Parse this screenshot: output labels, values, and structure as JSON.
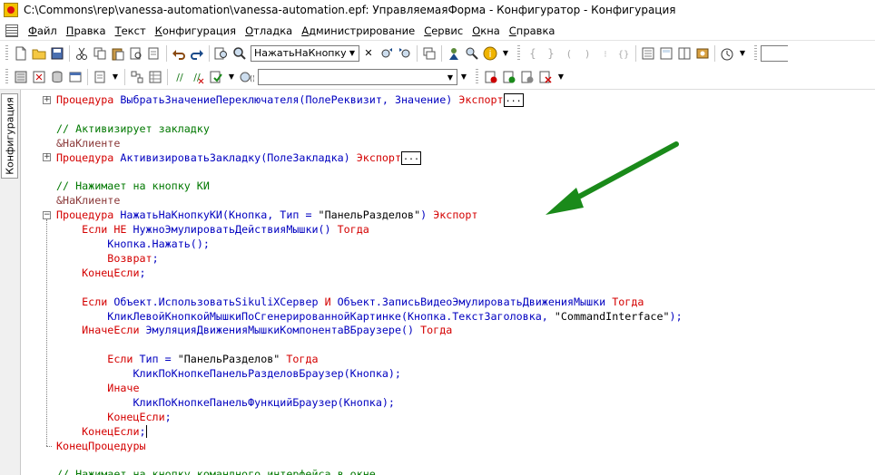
{
  "window": {
    "title": "C:\\Commons\\rep\\vanessa-automation\\vanessa-automation.epf: УправляемаяФорма - Конфигуратор - Конфигурация"
  },
  "menu": [
    {
      "u": "Ф",
      "rest": "айл"
    },
    {
      "u": "П",
      "rest": "равка"
    },
    {
      "u": "Т",
      "rest": "екст"
    },
    {
      "u": "К",
      "rest": "онфигурация"
    },
    {
      "u": "О",
      "rest": "тладка"
    },
    {
      "u": "А",
      "rest": "дминистрирование"
    },
    {
      "u": "С",
      "rest": "ервис"
    },
    {
      "u": "О",
      "rest": "кна"
    },
    {
      "u": "С",
      "rest": "правка"
    }
  ],
  "toolbar": {
    "search_value": "НажатьНаКнопкуКИ",
    "second_combo_value": ""
  },
  "side_panel": {
    "tab_label": "Конфигурация"
  },
  "colors": {
    "keyword": "#d40000",
    "identifier": "#0000c0",
    "comment": "#007800",
    "arrow": "#1a8a1a"
  },
  "code": [
    {
      "tokens": [
        [
          "kw",
          "Процедура "
        ],
        [
          "id",
          "ВыбратьЗначениеПереключателя"
        ],
        [
          "id",
          "(ПолеРеквизит, Значение) "
        ],
        [
          "kw",
          "Экспорт"
        ]
      ],
      "ellipsis": true,
      "fold": "+"
    },
    {
      "tokens": []
    },
    {
      "tokens": [
        [
          "cm",
          "// Активизирует закладку"
        ]
      ]
    },
    {
      "tokens": [
        [
          "pp",
          "&НаКлиенте"
        ]
      ]
    },
    {
      "tokens": [
        [
          "kw",
          "Процедура "
        ],
        [
          "id",
          "АктивизироватьЗакладку"
        ],
        [
          "id",
          "(ПолеЗакладка) "
        ],
        [
          "kw",
          "Экспорт"
        ]
      ],
      "ellipsis": true,
      "fold": "+"
    },
    {
      "tokens": []
    },
    {
      "tokens": [
        [
          "cm",
          "// Нажимает на кнопку КИ"
        ]
      ]
    },
    {
      "tokens": [
        [
          "pp",
          "&НаКлиенте"
        ]
      ]
    },
    {
      "tokens": [
        [
          "kw",
          "Процедура "
        ],
        [
          "id",
          "НажатьНаКнопкуКИ"
        ],
        [
          "id",
          "(Кнопка, Тип = "
        ],
        [
          "str",
          "\"ПанельРазделов\""
        ],
        [
          "id",
          ") "
        ],
        [
          "kw",
          "Экспорт"
        ]
      ],
      "fold": "-"
    },
    {
      "tokens": [
        [
          "kw",
          "    Если НЕ "
        ],
        [
          "id",
          "НужноЭмулироватьДействияМышки"
        ],
        [
          "id",
          "() "
        ],
        [
          "kw",
          "Тогда"
        ]
      ]
    },
    {
      "tokens": [
        [
          "id",
          "        Кнопка.Нажать"
        ],
        [
          "id",
          "();"
        ]
      ]
    },
    {
      "tokens": [
        [
          "kw",
          "        Возврат"
        ],
        [
          "id",
          ";"
        ]
      ]
    },
    {
      "tokens": [
        [
          "kw",
          "    КонецЕсли"
        ],
        [
          "id",
          ";"
        ]
      ]
    },
    {
      "tokens": []
    },
    {
      "tokens": [
        [
          "kw",
          "    Если "
        ],
        [
          "id",
          "Объект.ИспользоватьSikuliXСервер "
        ],
        [
          "kw",
          "И "
        ],
        [
          "id",
          "Объект.ЗаписьВидеоЭмулироватьДвиженияМышки "
        ],
        [
          "kw",
          "Тогда"
        ]
      ]
    },
    {
      "tokens": [
        [
          "id",
          "        КликЛевойКнопкойМышкиПоСгенерированнойКартинке(Кнопка.ТекстЗаголовка, "
        ],
        [
          "str",
          "\"CommandInterface\""
        ],
        [
          "id",
          ");"
        ]
      ]
    },
    {
      "tokens": [
        [
          "kw",
          "    ИначеЕсли "
        ],
        [
          "id",
          "ЭмуляцияДвиженияМышкиКомпонентаВБраузере"
        ],
        [
          "id",
          "() "
        ],
        [
          "kw",
          "Тогда"
        ]
      ]
    },
    {
      "tokens": []
    },
    {
      "tokens": [
        [
          "kw",
          "        Если "
        ],
        [
          "id",
          "Тип = "
        ],
        [
          "str",
          "\"ПанельРазделов\" "
        ],
        [
          "kw",
          "Тогда"
        ]
      ]
    },
    {
      "tokens": [
        [
          "id",
          "            КликПоКнопкеПанельРазделовБраузер(Кнопка);"
        ]
      ]
    },
    {
      "tokens": [
        [
          "kw",
          "        Иначе"
        ]
      ]
    },
    {
      "tokens": [
        [
          "id",
          "            КликПоКнопкеПанельФункцийБраузер(Кнопка);"
        ]
      ]
    },
    {
      "tokens": [
        [
          "kw",
          "        КонецЕсли"
        ],
        [
          "id",
          ";"
        ]
      ]
    },
    {
      "tokens": [
        [
          "kw",
          "    КонецЕсли"
        ],
        [
          "id",
          ";"
        ]
      ],
      "cursor": true
    },
    {
      "tokens": [
        [
          "kw",
          "КонецПроцедуры"
        ]
      ]
    },
    {
      "tokens": []
    },
    {
      "tokens": [
        [
          "cm",
          "// Нажимает на кнопку командного интерфейса в окне"
        ]
      ]
    }
  ]
}
